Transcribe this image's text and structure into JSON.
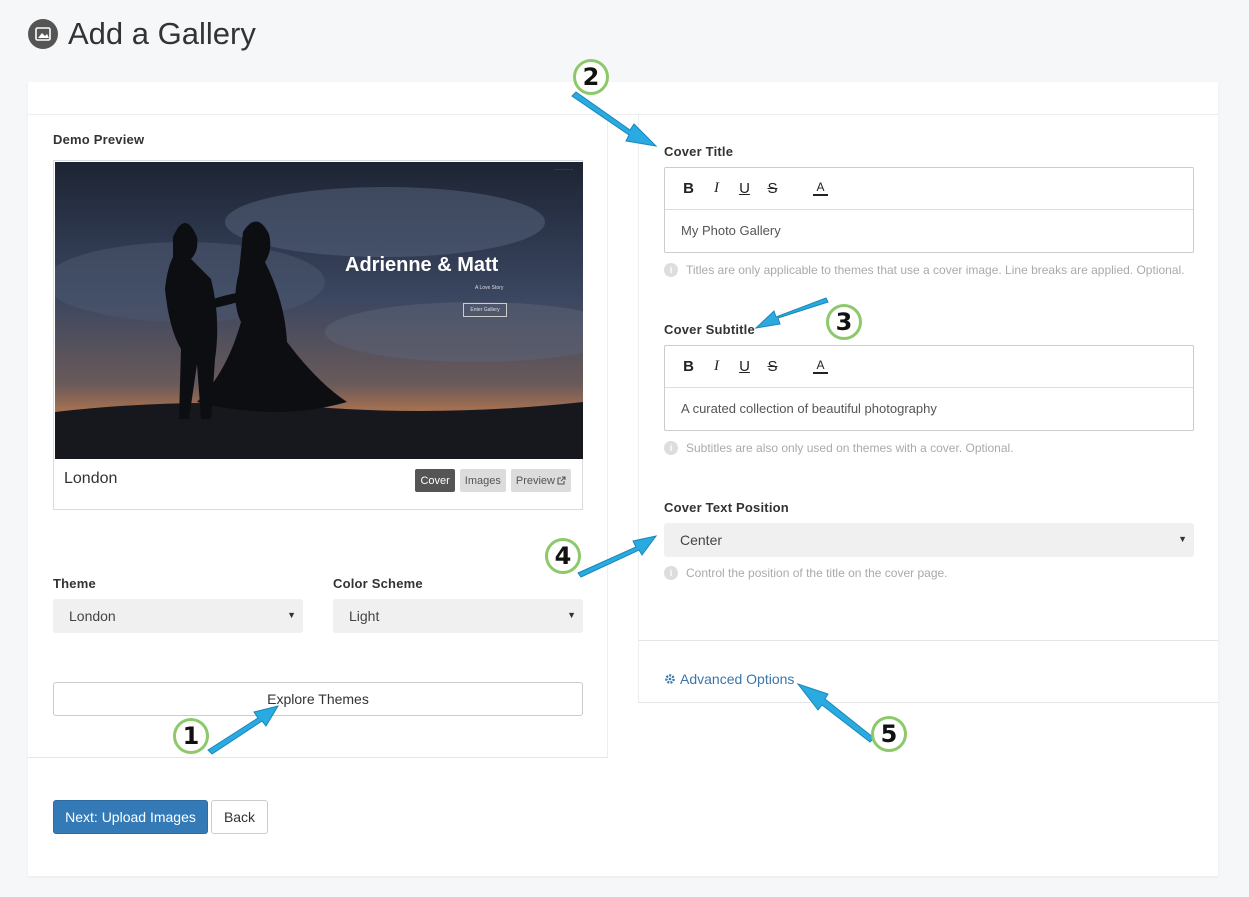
{
  "page": {
    "title": "Add a Gallery",
    "icon": "image-icon"
  },
  "preview": {
    "label": "Demo Preview",
    "cover_title": "Adrienne & Matt",
    "cover_subtitle": "A Love Story",
    "cover_button": "Enter Gallery",
    "theme_name": "London",
    "buttons": {
      "cover": "Cover",
      "images": "Images",
      "preview": "Preview"
    }
  },
  "theme": {
    "label": "Theme",
    "value": "London"
  },
  "color_scheme": {
    "label": "Color Scheme",
    "value": "Light"
  },
  "explore_button": "Explore Themes",
  "cover_title": {
    "label": "Cover Title",
    "value": "My Photo Gallery",
    "help": "Titles are only applicable to themes that use a cover image. Line breaks are applied. Optional."
  },
  "cover_subtitle": {
    "label": "Cover Subtitle",
    "value": "A curated collection of beautiful photography",
    "help": "Subtitles are also only used on themes with a cover. Optional."
  },
  "cover_text_position": {
    "label": "Cover Text Position",
    "value": "Center",
    "help": "Control the position of the title on the cover page."
  },
  "editor_toolbar": {
    "bold": "B",
    "italic": "I",
    "underline": "U",
    "strike": "S",
    "color": "A"
  },
  "advanced_options": "Advanced Options",
  "actions": {
    "next": "Next: Upload Images",
    "back": "Back"
  },
  "callouts": {
    "one": "1",
    "two": "2",
    "three": "3",
    "four": "4",
    "five": "5"
  },
  "colors": {
    "primary": "#337ab7",
    "link": "#3a76a8",
    "callout_border": "#8cc96b",
    "arrow": "#29aae1"
  }
}
